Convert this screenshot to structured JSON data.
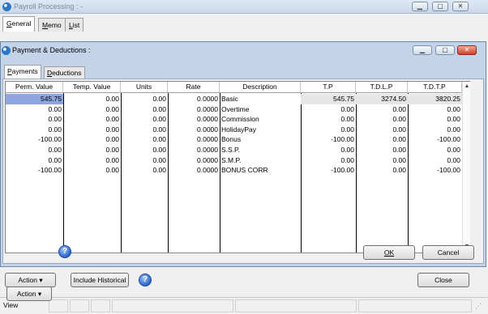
{
  "back_window": {
    "title": "Payroll Processing : -",
    "tabs": [
      {
        "pre": "",
        "u": "G",
        "post": "eneral"
      },
      {
        "pre": "",
        "u": "M",
        "post": "emo"
      },
      {
        "pre": "",
        "u": "L",
        "post": "ist"
      }
    ],
    "buttons": {
      "action_label": "Action",
      "include_historical_label": "Include Historical",
      "close_label": "Close"
    },
    "status": {
      "view_label": "View"
    }
  },
  "dialog": {
    "title": "Payment & Deductions :",
    "tabs": [
      {
        "pre": "",
        "u": "P",
        "post": "ayments"
      },
      {
        "pre": "",
        "u": "D",
        "post": "eductions"
      }
    ],
    "columns": [
      "Perm. Value",
      "Temp. Value",
      "Units",
      "Rate",
      "Description",
      "T.P",
      "T.D.L.P",
      "T.D.T.P"
    ],
    "rows": [
      [
        "545.75",
        "0.00",
        "0.00",
        "0.0000",
        "Basic",
        "545.75",
        "3274.50",
        "3820.25"
      ],
      [
        "0.00",
        "0.00",
        "0.00",
        "0.0000",
        "Overtime",
        "0.00",
        "0.00",
        "0.00"
      ],
      [
        "0.00",
        "0.00",
        "0.00",
        "0.0000",
        "Commission",
        "0.00",
        "0.00",
        "0.00"
      ],
      [
        "0.00",
        "0.00",
        "0.00",
        "0.0000",
        "HolidayPay",
        "0.00",
        "0.00",
        "0.00"
      ],
      [
        "-100.00",
        "0.00",
        "0.00",
        "0.0000",
        "Bonus",
        "-100.00",
        "0.00",
        "-100.00"
      ],
      [
        "0.00",
        "0.00",
        "0.00",
        "0.0000",
        "S.S.P.",
        "0.00",
        "0.00",
        "0.00"
      ],
      [
        "0.00",
        "0.00",
        "0.00",
        "0.0000",
        "S.M.P.",
        "0.00",
        "0.00",
        "0.00"
      ],
      [
        "-100.00",
        "0.00",
        "0.00",
        "0.0000",
        "BONUS CORR",
        "-100.00",
        "0.00",
        "-100.00"
      ]
    ],
    "buttons": {
      "action_label": "Action",
      "ok_label": "OK",
      "cancel_label": "Cancel"
    }
  },
  "colors": {
    "selected_cell": "#8fa5e0",
    "dialog_frame": "#c4d4e8"
  }
}
